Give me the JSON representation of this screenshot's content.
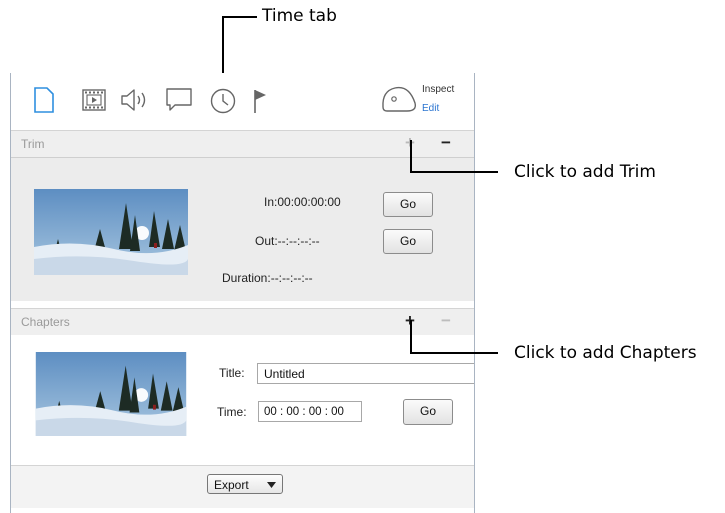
{
  "annotations": {
    "time_tab": "Time tab",
    "add_trim": "Click to add Trim",
    "add_chapters": "Click to add Chapters"
  },
  "toolbar": {
    "inspect_label": "Inspect",
    "edit_label": "Edit",
    "tab_icons": [
      "document-icon",
      "film-icon",
      "speaker-icon",
      "comment-icon",
      "clock-icon",
      "flag-icon"
    ]
  },
  "trim": {
    "title": "Trim",
    "add_symbol": "+",
    "remove_symbol": "−",
    "in_text": "In:00:00:00:00",
    "out_text": "Out:--:--:--:--",
    "duration_text": "Duration:--:--:--:--",
    "go_in_label": "Go",
    "go_out_label": "Go"
  },
  "chapters": {
    "title": "Chapters",
    "add_symbol": "+",
    "remove_symbol": "−",
    "title_label": "Title:",
    "title_value": "Untitled",
    "time_label": "Time:",
    "time_value": "00 : 00 : 00 : 00",
    "go_label": "Go"
  },
  "footer": {
    "export_label": "Export"
  },
  "colors": {
    "accent": "#2a74d0",
    "icon_blue": "#2f8fdf",
    "icon_gray": "#666666"
  }
}
